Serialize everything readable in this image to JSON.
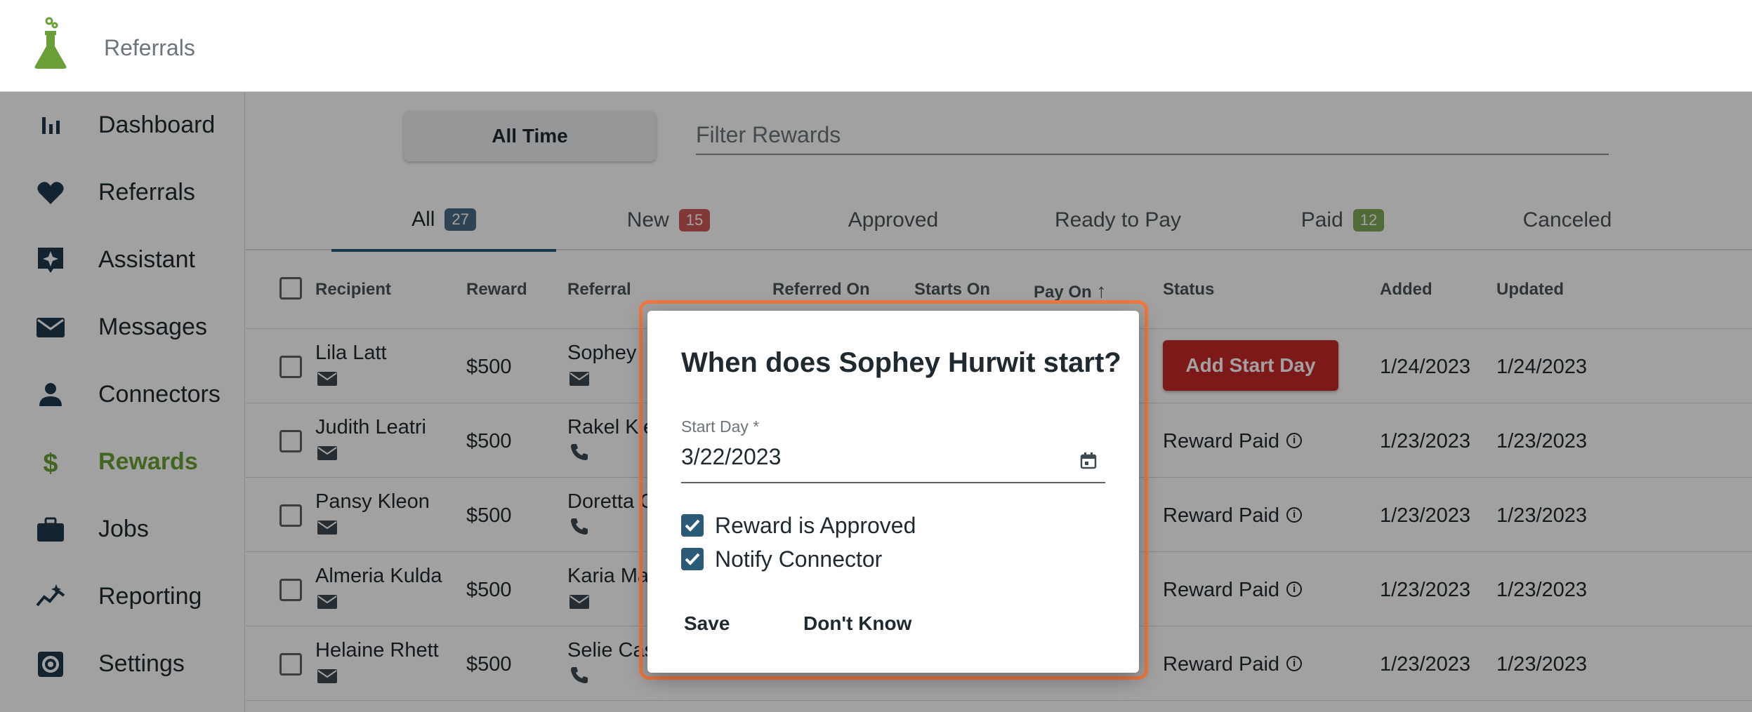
{
  "app": {
    "title": "Referrals"
  },
  "sidebar": {
    "items": [
      {
        "label": "Dashboard",
        "icon": "bar-chart-icon"
      },
      {
        "label": "Referrals",
        "icon": "heart-icon"
      },
      {
        "label": "Assistant",
        "icon": "sparkle-icon"
      },
      {
        "label": "Messages",
        "icon": "envelope-icon"
      },
      {
        "label": "Connectors",
        "icon": "person-icon"
      },
      {
        "label": "Rewards",
        "icon": "dollar-icon",
        "active": true
      },
      {
        "label": "Jobs",
        "icon": "briefcase-icon"
      },
      {
        "label": "Reporting",
        "icon": "trend-icon"
      },
      {
        "label": "Settings",
        "icon": "gear-icon"
      }
    ]
  },
  "toolbar": {
    "range_label": "All Time",
    "filter_placeholder": "Filter Rewards"
  },
  "tabs": [
    {
      "label": "All",
      "count": "27",
      "badge_color": "#4a6b84",
      "active": true
    },
    {
      "label": "New",
      "count": "15",
      "badge_color": "#d05a5a"
    },
    {
      "label": "Approved"
    },
    {
      "label": "Ready to Pay"
    },
    {
      "label": "Paid",
      "count": "12",
      "badge_color": "#7fa85a"
    },
    {
      "label": "Canceled"
    }
  ],
  "table": {
    "columns": [
      "Recipient",
      "Reward",
      "Referral",
      "Referred On",
      "Starts On",
      "Pay On",
      "Status",
      "Added",
      "Updated"
    ],
    "sort_indicator": "↑",
    "rows": [
      {
        "recipient": "Lila Latt",
        "recipient_contact": "email",
        "reward": "$500",
        "referral": "Sophey",
        "referral_contact": "email",
        "status": "Add Start Day",
        "status_type": "button",
        "added": "1/24/2023",
        "updated": "1/24/2023"
      },
      {
        "recipient": "Judith Leatri",
        "recipient_contact": "email",
        "reward": "$500",
        "referral": "Rakel Kie",
        "referral_contact": "phone",
        "status": "Reward Paid",
        "status_type": "text",
        "added": "1/23/2023",
        "updated": "1/23/2023"
      },
      {
        "recipient": "Pansy Kleon",
        "recipient_contact": "email",
        "reward": "$500",
        "referral": "Doretta G",
        "referral_contact": "phone",
        "status": "Reward Paid",
        "status_type": "text",
        "added": "1/23/2023",
        "updated": "1/23/2023"
      },
      {
        "recipient": "Almeria Kulda",
        "recipient_contact": "email",
        "reward": "$500",
        "referral": "Karia Mal",
        "referral_contact": "email",
        "status": "Reward Paid",
        "status_type": "text",
        "added": "1/23/2023",
        "updated": "1/23/2023"
      },
      {
        "recipient": "Helaine Rhett",
        "recipient_contact": "email",
        "reward": "$500",
        "referral": "Selie Cas",
        "referral_contact": "phone",
        "status": "Reward Paid",
        "status_type": "text",
        "added": "1/23/2023",
        "updated": "1/23/2023"
      }
    ]
  },
  "dialog": {
    "title": "When does Sophey Hurwit start?",
    "field_label": "Start Day *",
    "field_value": "3/22/2023",
    "checkboxes": [
      {
        "label": "Reward is Approved",
        "checked": true
      },
      {
        "label": "Notify Connector",
        "checked": true
      }
    ],
    "save_label": "Save",
    "dont_know_label": "Don't Know"
  },
  "colors": {
    "brand_green": "#6aa037",
    "accent_blue": "#2b5a78",
    "danger_red": "#c62828",
    "dialog_ring": "#f07840"
  }
}
